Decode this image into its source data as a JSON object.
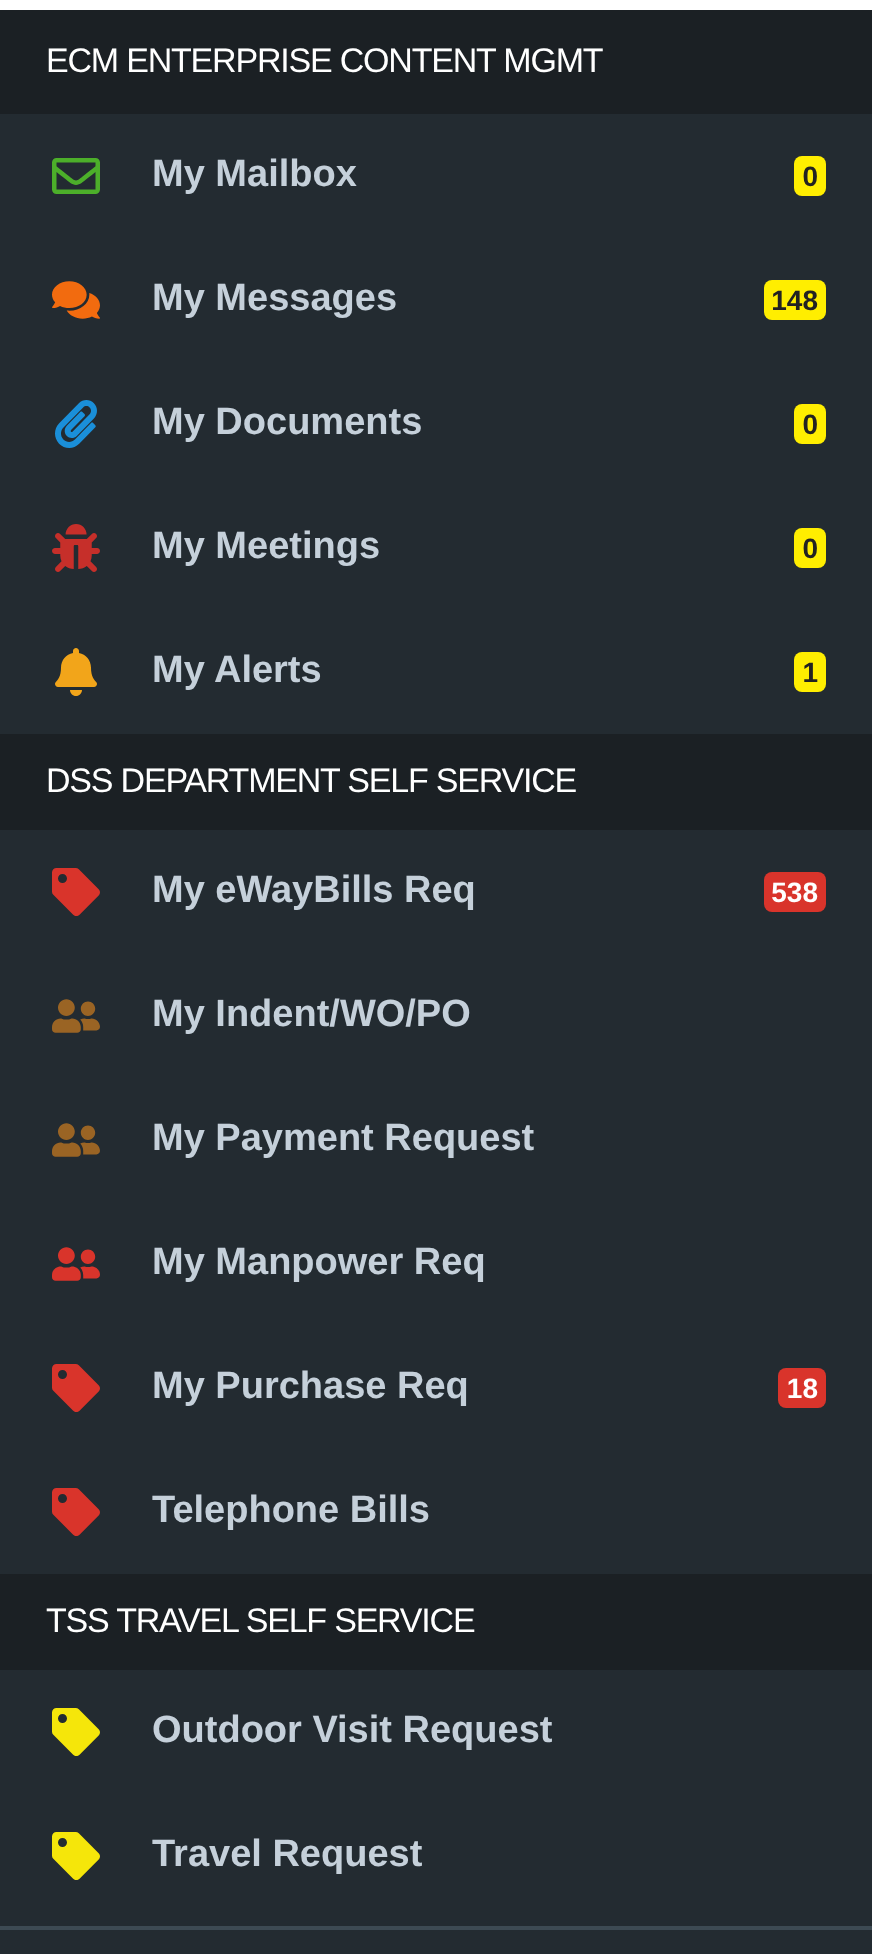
{
  "sections": [
    {
      "title": "ECM ENTERPRISE CONTENT MGMT",
      "items": [
        {
          "label": "My Mailbox",
          "kind": "mail",
          "color": "#4caf2a",
          "badge": {
            "text": "0",
            "kind": "warning"
          }
        },
        {
          "label": "My Messages",
          "kind": "chat",
          "color": "#f26b0f",
          "badge": {
            "text": "148",
            "kind": "warning"
          }
        },
        {
          "label": "My Documents",
          "kind": "clip",
          "color": "#1a8fd9",
          "badge": {
            "text": "0",
            "kind": "warning"
          }
        },
        {
          "label": "My Meetings",
          "kind": "bug",
          "color": "#c62f2a",
          "badge": {
            "text": "0",
            "kind": "warning"
          }
        },
        {
          "label": "My Alerts",
          "kind": "bell",
          "color": "#f2a51a",
          "badge": {
            "text": "1",
            "kind": "warning"
          }
        }
      ]
    },
    {
      "title": "DSS DEPARTMENT SELF SERVICE",
      "items": [
        {
          "label": "My eWayBills Req",
          "kind": "tag",
          "color": "#d9342b",
          "badge": {
            "text": "538",
            "kind": "danger"
          }
        },
        {
          "label": "My Indent/WO/PO",
          "kind": "users",
          "color": "#9a6424"
        },
        {
          "label": "My Payment Request",
          "kind": "users",
          "color": "#9a6424"
        },
        {
          "label": "My Manpower Req",
          "kind": "users",
          "color": "#d9342b"
        },
        {
          "label": "My Purchase Req",
          "kind": "tag",
          "color": "#d9342b",
          "badge": {
            "text": "18",
            "kind": "danger"
          }
        },
        {
          "label": "Telephone Bills",
          "kind": "tag",
          "color": "#d9342b"
        }
      ]
    },
    {
      "title": "TSS TRAVEL SELF SERVICE",
      "items": [
        {
          "label": "Outdoor Visit Request",
          "kind": "tag",
          "color": "#f5e60a"
        },
        {
          "label": "Travel Request",
          "kind": "tag",
          "color": "#f5e60a"
        }
      ]
    }
  ]
}
